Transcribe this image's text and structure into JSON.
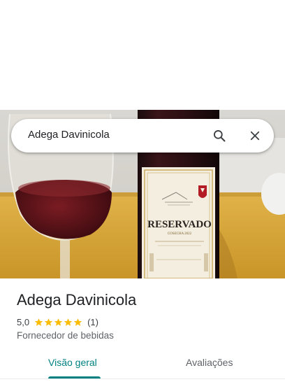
{
  "search": {
    "query": "Adega Davinicola"
  },
  "photo": {
    "bottle_label_text": "RESERVADO",
    "bottle_label_subtext": "COSECHA 2022"
  },
  "place": {
    "name": "Adega Davinicola",
    "rating": "5,0",
    "stars": 5,
    "review_count": "(1)",
    "category": "Fornecedor de bebidas"
  },
  "tabs": [
    {
      "label": "Visão geral",
      "active": true
    },
    {
      "label": "Avaliações",
      "active": false
    }
  ],
  "colors": {
    "accent": "#008080",
    "star": "#fbbc04"
  }
}
